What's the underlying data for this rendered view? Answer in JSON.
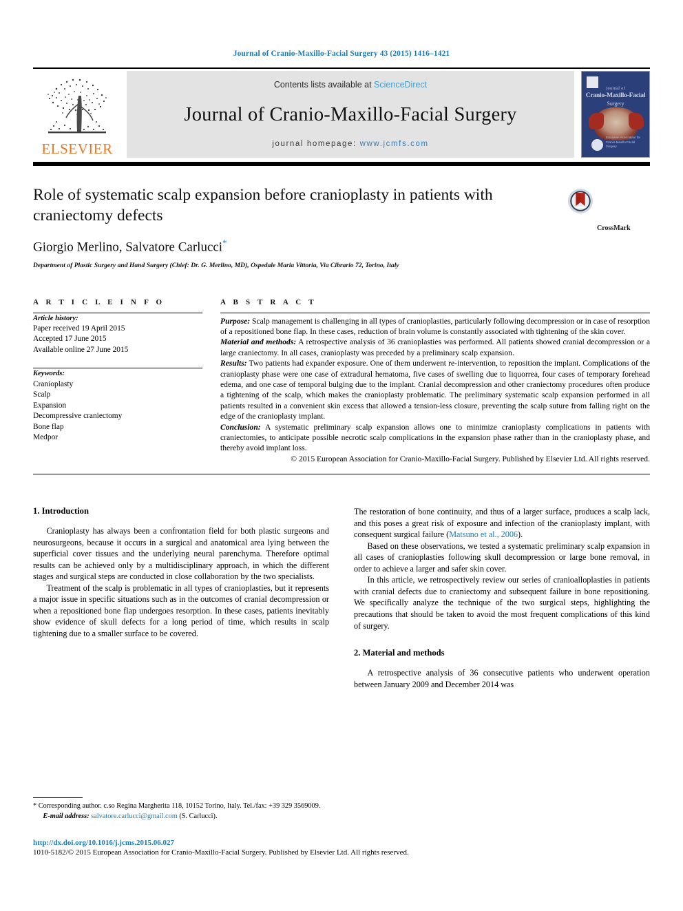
{
  "running_head": "Journal of Cranio-Maxillo-Facial Surgery 43 (2015) 1416–1421",
  "masthead": {
    "elsevier_wordmark": "ELSEVIER",
    "contents_prefix": "Contents lists available at",
    "sciencedirect": "ScienceDirect",
    "journal_title": "Journal of Cranio-Maxillo-Facial Surgery",
    "homepage_prefix": "journal homepage:",
    "homepage_url": "www.jcmfs.com",
    "cover": {
      "line1": "Journal of",
      "line2": "Cranio-Maxillo-Facial",
      "line3": "Surgery",
      "society": "European Association for Cranio-Maxillo-Facial Surgery"
    },
    "link_color": "#3fa0d3",
    "band_bg": "#e3e3e3",
    "elsevier_orange": "#E87722"
  },
  "title": "Role of systematic scalp expansion before cranioplasty in patients with craniectomy defects",
  "authors": "Giorgio Merlino, Salvatore Carlucci",
  "author_footnote_marker": "*",
  "affiliation": "Department of Plastic Surgery and Hand Surgery (Chief: Dr. G. Merlino, MD), Ospedale Maria Vittoria, Via Cibrario 72, Torino, Italy",
  "crossmark_label": "CrossMark",
  "article_info": {
    "heading": "A R T I C L E   I N F O",
    "history_label": "Article history:",
    "history": [
      "Paper received 19 April 2015",
      "Accepted 17 June 2015",
      "Available online 27 June 2015"
    ],
    "keywords_label": "Keywords:",
    "keywords": [
      "Cranioplasty",
      "Scalp",
      "Expansion",
      "Decompressive craniectomy",
      "Bone flap",
      "Medpor"
    ]
  },
  "abstract": {
    "heading": "A B S T R A C T",
    "sections": [
      {
        "label": "Purpose:",
        "text": " Scalp management is challenging in all types of cranioplasties, particularly following decompression or in case of resorption of a repositioned bone flap. In these cases, reduction of brain volume is constantly associated with tightening of the skin cover."
      },
      {
        "label": "Material and methods:",
        "text": " A retrospective analysis of 36 cranioplasties was performed. All patients showed cranial decompression or a large craniectomy. In all cases, cranioplasty was preceded by a preliminary scalp expansion."
      },
      {
        "label": "Results:",
        "text": " Two patients had expander exposure. One of them underwent re-intervention, to reposition the implant. Complications of the cranioplasty phase were one case of extradural hematoma, five cases of swelling due to liquorrea, four cases of temporary forehead edema, and one case of temporal bulging due to the implant. Cranial decompression and other craniectomy procedures often produce a tightening of the scalp, which makes the cranioplasty problematic. The preliminary systematic scalp expansion performed in all patients resulted in a convenient skin excess that allowed a tension-less closure, preventing the scalp suture from falling right on the edge of the cranioplasty implant."
      },
      {
        "label": "Conclusion:",
        "text": " A systematic preliminary scalp expansion allows one to minimize cranioplasty complications in patients with craniectomies, to anticipate possible necrotic scalp complications in the expansion phase rather than in the cranioplasty phase, and thereby avoid implant loss."
      }
    ],
    "copyright": "© 2015 European Association for Cranio-Maxillo-Facial Surgery. Published by Elsevier Ltd. All rights reserved."
  },
  "body": {
    "left": {
      "heading": "1. Introduction",
      "paragraphs": [
        "Cranioplasty has always been a confrontation field for both plastic surgeons and neurosurgeons, because it occurs in a surgical and anatomical area lying between the superficial cover tissues and the underlying neural parenchyma. Therefore optimal results can be achieved only by a multidisciplinary approach, in which the different stages and surgical steps are conducted in close collaboration by the two specialists.",
        "Treatment of the scalp is problematic in all types of cranioplasties, but it represents a major issue in specific situations such as in the outcomes of cranial decompression or when a repositioned bone flap undergoes resorption. In these cases, patients inevitably show evidence of skull defects for a long period of time, which results in scalp tightening due to a smaller surface to be covered."
      ]
    },
    "right": {
      "paragraph_continued_pre": "The restoration of bone continuity, and thus of a larger surface, produces a scalp lack, and this poses a great risk of exposure and infection of the cranioplasty implant, with consequent surgical failure (",
      "citation": "Matsuno et al., 2006",
      "paragraph_continued_post": ").",
      "paragraphs": [
        "Based on these observations, we tested a systematic preliminary scalp expansion in all cases of cranioplasties following skull decompression or large bone removal, in order to achieve a larger and safer skin cover.",
        "In this article, we retrospectively review our series of cranioalloplasties in patients with cranial defects due to craniectomy and subsequent failure in bone repositioning. We specifically analyze the technique of the two surgical steps, highlighting the precautions that should be taken to avoid the most frequent complications of this kind of surgery."
      ],
      "heading2": "2. Material and methods",
      "paragraph2": "A retrospective analysis of 36 consecutive patients who underwent operation between January 2009 and December 2014 was"
    }
  },
  "footnotes": {
    "corresponding": "* Corresponding author. c.so Regina Margherita 118, 10152 Torino, Italy. Tel./fax: +39 329 3569009.",
    "email_label": "E-mail address:",
    "email": "salvatore.carlucci@gmail.com",
    "email_suffix": "(S. Carlucci)."
  },
  "bottom": {
    "doi": "http://dx.doi.org/10.1016/j.jcms.2015.06.027",
    "issn_line": "1010-5182/© 2015 European Association for Cranio-Maxillo-Facial Surgery. Published by Elsevier Ltd. All rights reserved."
  }
}
